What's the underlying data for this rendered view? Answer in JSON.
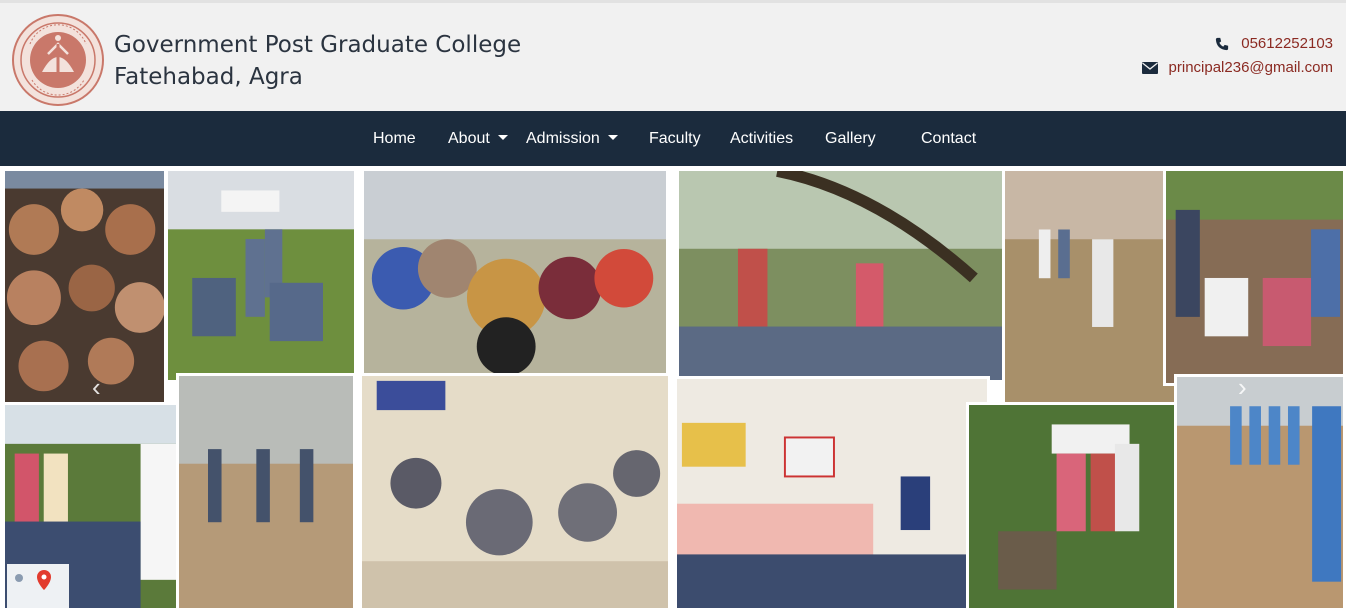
{
  "header": {
    "college_name_line1": "Government Post Graduate College",
    "college_name_line2": "Fatehabad, Agra",
    "phone": "05612252103",
    "email": "principal236@gmail.com"
  },
  "nav": {
    "items": [
      {
        "label": "Home",
        "has_dropdown": false
      },
      {
        "label": "About",
        "has_dropdown": true
      },
      {
        "label": "Admission",
        "has_dropdown": true
      },
      {
        "label": "Faculty",
        "has_dropdown": false
      },
      {
        "label": "Activities",
        "has_dropdown": false
      },
      {
        "label": "Gallery",
        "has_dropdown": false
      },
      {
        "label": "Contact",
        "has_dropdown": false
      }
    ]
  },
  "slider": {
    "prev_icon": "chevron-left-icon",
    "next_icon": "chevron-right-icon"
  },
  "icons": {
    "phone": "phone-icon",
    "email": "envelope-icon",
    "logo": "college-emblem-logo"
  },
  "colors": {
    "header_bg": "#f1f1f1",
    "nav_bg": "#1b2b3d",
    "title_text": "#2b3440",
    "contact_link": "#8b2a22",
    "emblem": "#c9786a"
  }
}
